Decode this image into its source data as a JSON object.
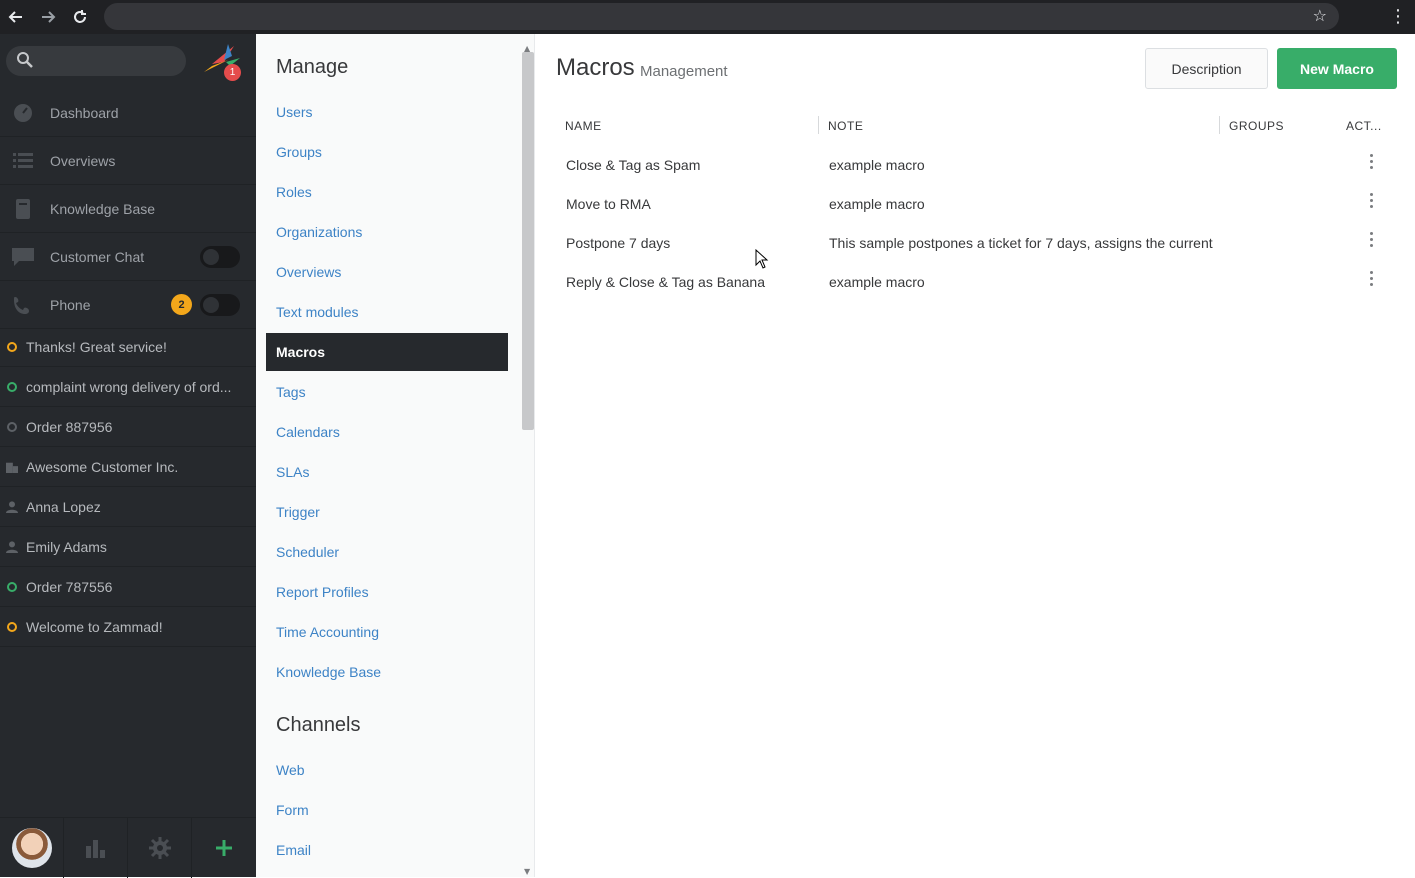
{
  "browser": {
    "back_icon": "back-arrow-icon",
    "forward_icon": "forward-arrow-icon",
    "reload_icon": "reload-icon",
    "address": ""
  },
  "nav": {
    "logo_badge": "1",
    "items": [
      {
        "label": "Dashboard",
        "icon": "dashboard-icon"
      },
      {
        "label": "Overviews",
        "icon": "list-icon"
      },
      {
        "label": "Knowledge Base",
        "icon": "book-icon"
      },
      {
        "label": "Customer Chat",
        "icon": "chat-icon"
      },
      {
        "label": "Phone",
        "icon": "phone-icon",
        "badge": "2"
      }
    ],
    "tasks": [
      {
        "label": "Thanks! Great service!",
        "status": "orange"
      },
      {
        "label": "complaint wrong delivery of ord...",
        "status": "green"
      },
      {
        "label": "Order 887956",
        "status": "grey"
      },
      {
        "label": "Awesome Customer Inc.",
        "status": "org"
      },
      {
        "label": "Anna Lopez",
        "status": "person"
      },
      {
        "label": "Emily Adams",
        "status": "person"
      },
      {
        "label": "Order 787556",
        "status": "green"
      },
      {
        "label": "Welcome to Zammad!",
        "status": "orange"
      }
    ]
  },
  "manage": {
    "heading": "Manage",
    "links": [
      "Users",
      "Groups",
      "Roles",
      "Organizations",
      "Overviews",
      "Text modules",
      "Macros",
      "Tags",
      "Calendars",
      "SLAs",
      "Trigger",
      "Scheduler",
      "Report Profiles",
      "Time Accounting",
      "Knowledge Base"
    ],
    "active": "Macros",
    "channels_heading": "Channels",
    "channel_links": [
      "Web",
      "Form",
      "Email"
    ]
  },
  "content": {
    "title": "Macros",
    "subtitle": "Management",
    "description_button": "Description",
    "new_button": "New Macro",
    "columns": {
      "name": "NAME",
      "note": "NOTE",
      "groups": "GROUPS",
      "actions": "ACT..."
    },
    "rows": [
      {
        "name": "Close & Tag as Spam",
        "note": "example macro",
        "groups": ""
      },
      {
        "name": "Move to RMA",
        "note": "example macro",
        "groups": ""
      },
      {
        "name": "Postpone 7 days",
        "note": "This sample postpones a ticket for 7 days, assigns the current",
        "groups": ""
      },
      {
        "name": "Reply & Close & Tag as Banana",
        "note": "example macro",
        "groups": ""
      }
    ]
  }
}
